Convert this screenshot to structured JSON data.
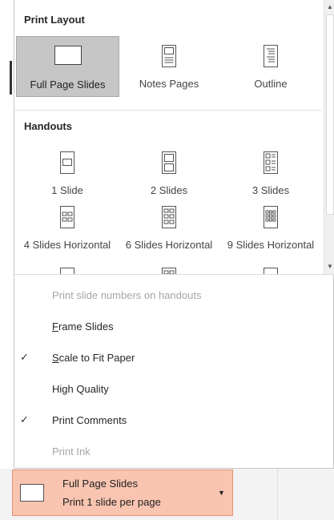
{
  "print_layout": {
    "title": "Print Layout",
    "items": [
      {
        "label": "Full Page Slides",
        "selected": true
      },
      {
        "label": "Notes Pages",
        "selected": false
      },
      {
        "label": "Outline",
        "selected": false
      }
    ]
  },
  "handouts": {
    "title": "Handouts",
    "items": [
      {
        "label": "1 Slide"
      },
      {
        "label": "2 Slides"
      },
      {
        "label": "3 Slides"
      },
      {
        "label": "4 Slides Horizontal"
      },
      {
        "label": "6 Slides Horizontal"
      },
      {
        "label": "9 Slides Horizontal"
      }
    ]
  },
  "options": [
    {
      "label": "Print slide numbers on handouts",
      "checked": false,
      "enabled": false
    },
    {
      "label_accel": "F",
      "label_rest": "rame Slides",
      "checked": false,
      "enabled": true
    },
    {
      "label_accel": "S",
      "label_rest": "cale to Fit Paper",
      "checked": true,
      "enabled": true
    },
    {
      "label": "High Quality",
      "checked": false,
      "enabled": true
    },
    {
      "label": "Print Comments",
      "checked": true,
      "enabled": true
    },
    {
      "label": "Print Ink",
      "checked": false,
      "enabled": false
    }
  ],
  "checkmark": "✓",
  "dropdown": {
    "line1": "Full Page Slides",
    "line2": "Print 1 slide per page"
  },
  "colors": {
    "dropdown_bg": "#f9c4b0",
    "dropdown_border": "#e8917a",
    "selected_bg": "#c6c6c6"
  }
}
